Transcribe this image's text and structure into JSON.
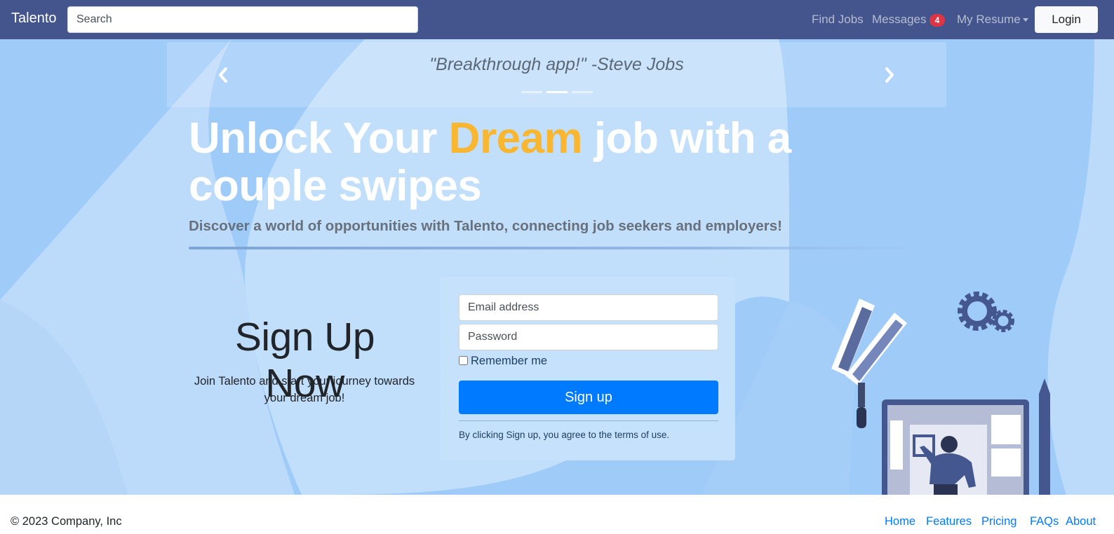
{
  "navbar": {
    "brand": "Talento",
    "search_placeholder": "Search",
    "links": {
      "find_jobs": "Find Jobs",
      "messages": "Messages",
      "messages_count": "4",
      "my_resume": "My Resume"
    },
    "login_label": "Login"
  },
  "carousel": {
    "quote": "\"Breakthrough app!\" -Steve Jobs",
    "slide_count": 3,
    "active_slide": 2
  },
  "hero": {
    "headline_before": "Unlock Your ",
    "headline_accent": "Dream",
    "headline_after": " job with a couple swipes",
    "subheadline": "Discover a world of opportunities with Talento, connecting job seekers and employers!"
  },
  "signup": {
    "title": "Sign Up Now",
    "description": "Join Talento and start your journey towards your dream job!",
    "email_placeholder": "Email address",
    "password_placeholder": "Password",
    "remember_label": "Remember me",
    "submit_label": "Sign up",
    "terms": "By clicking Sign up, you agree to the terms of use."
  },
  "footer": {
    "copyright": "© 2023 Company, Inc",
    "links": {
      "home": "Home",
      "features": "Features",
      "pricing": "Pricing",
      "faqs": "FAQs",
      "about": "About"
    }
  },
  "colors": {
    "navbar": "#43558c",
    "hero_bg": "#9fcbf9",
    "accent_yellow": "#f8b631",
    "primary": "#007bff",
    "badge": "#dc3545"
  }
}
